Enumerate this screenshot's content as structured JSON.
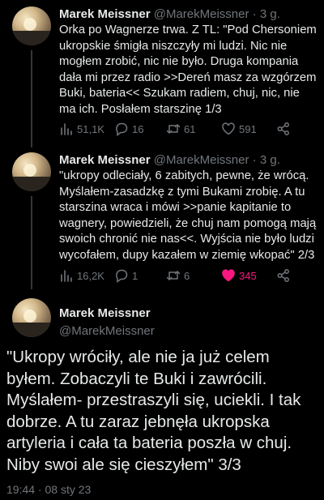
{
  "tweets": [
    {
      "name": "Marek Meissner",
      "handle": "@MarekMeissner",
      "dot": "·",
      "time": "3 g.",
      "text": "Orka po Wagnerze trwa. Z TL: \"Pod Chersoniem ukropskie śmigła niszczyły mi ludzi. Nic nie mogłem zrobić, nic nie było. Druga kompania dała mi przez radio >>Dereń masz za wzgórzem Buki, bateria<< Szukam radiem, chuj, nic, nie ma ich. Posłałem starszinę 1/3",
      "views": "51,1K",
      "replies": "16",
      "retweets": "61",
      "likes": "591"
    },
    {
      "name": "Marek Meissner",
      "handle": "@MarekMeissner",
      "dot": "·",
      "time": "3 g.",
      "text": "\"ukropy odleciały, 6 zabitych, pewne, że wrócą. Myślałem-zasadzkę z tymi Bukami zrobię. A tu starszina wraca i mówi >>panie kapitanie to wagnery, powiedzieli, że chuj nam pomogą mają swoich chronić nie nas<<. Wyjścia nie było ludzi wycofałem, dupy kazałem w ziemię wkopać\" 2/3",
      "views": "16,2K",
      "replies": "1",
      "retweets": "6",
      "likes": "345"
    }
  ],
  "main": {
    "name": "Marek Meissner",
    "handle": "@MarekMeissner",
    "text": "\"Ukropy wróciły, ale nie ja już celem byłem. Zobaczyli te Buki i zawrócili. Myślałem- przestraszyli się, uciekli. I tak dobrze. A tu zaraz jebnęła ukropska artyleria i cała ta bateria poszła w chuj. Niby swoi ale się cieszyłem\" 3/3",
    "timestamp": "19:44 · 08 sty 23"
  },
  "colors": {
    "background": "#000000",
    "text": "#e7e9ea",
    "secondary": "#71767b",
    "like": "#f91880",
    "thread_line": "#333639"
  },
  "icons": [
    "views-icon",
    "reply-icon",
    "retweet-icon",
    "like-icon",
    "share-icon"
  ]
}
